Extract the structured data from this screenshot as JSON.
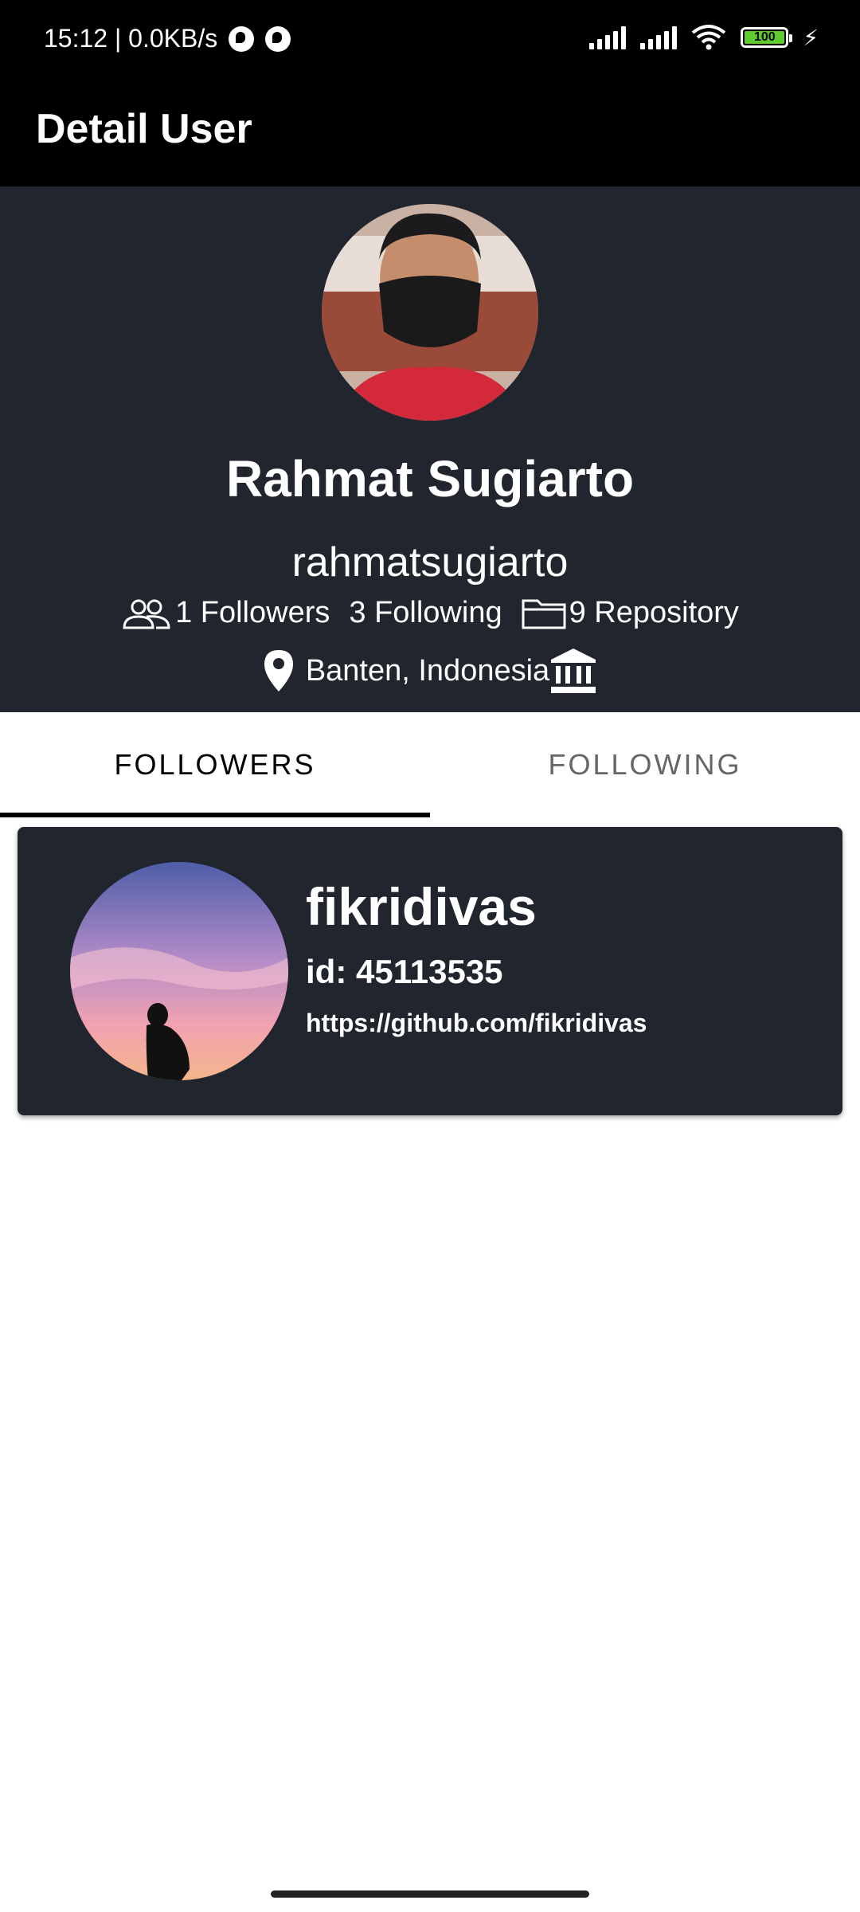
{
  "status_bar": {
    "time_speed": "15:12 | 0.0KB/s",
    "battery_level": "100"
  },
  "app_bar": {
    "title": "Detail User"
  },
  "profile": {
    "name": "Rahmat Sugiarto",
    "login": "rahmatsugiarto",
    "followers": "1 Followers",
    "following": "3 Following",
    "repository": "9 Repository",
    "location": "Banten, Indonesia"
  },
  "tabs": [
    {
      "label": "FOLLOWERS",
      "selected": true
    },
    {
      "label": "FOLLOWING",
      "selected": false
    }
  ],
  "followers_list": [
    {
      "login": "fikridivas",
      "id_text": "id: 45113535",
      "url": "https://github.com/fikridivas"
    }
  ]
}
